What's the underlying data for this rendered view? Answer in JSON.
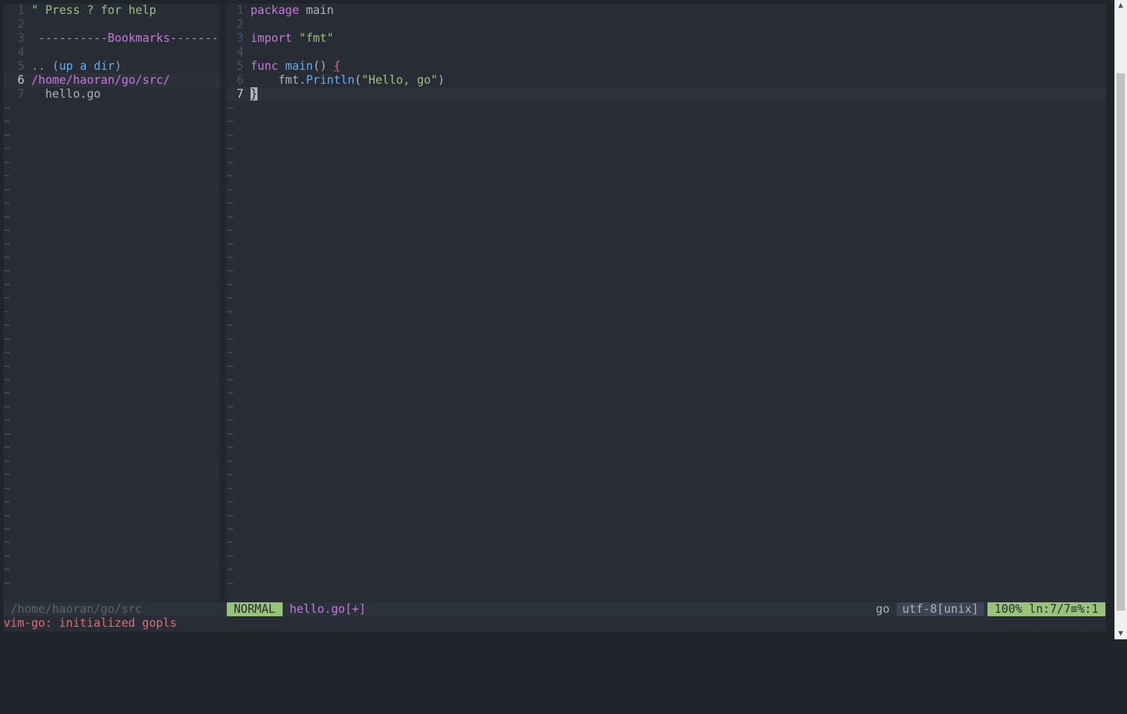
{
  "left_pane": {
    "lines": [
      {
        "num": "1",
        "text": "\" Press ? for help"
      },
      {
        "num": "2",
        "text": ""
      },
      {
        "num": "3",
        "text": " ----------Bookmarks-------"
      },
      {
        "num": "4",
        "text": ""
      },
      {
        "num": "5",
        "text": ".. (up a dir)"
      },
      {
        "num": "6",
        "text": "/home/haoran/go/src/"
      },
      {
        "num": "7",
        "text": "  hello.go"
      }
    ],
    "empty_marker": "~"
  },
  "right_pane": {
    "lines": [
      {
        "num": "1",
        "tokens": [
          "package",
          " main"
        ]
      },
      {
        "num": "2",
        "tokens": []
      },
      {
        "num": "3",
        "tokens": [
          "import",
          " \"fmt\""
        ]
      },
      {
        "num": "4",
        "tokens": []
      },
      {
        "num": "5",
        "tokens": [
          "func",
          " ",
          "main",
          "() ",
          "{"
        ]
      },
      {
        "num": "6",
        "tokens": [
          "    fmt.",
          "Println",
          "(",
          "\"Hello, go\"",
          ")"
        ]
      },
      {
        "num": "7",
        "tokens": [
          "}"
        ]
      }
    ],
    "empty_marker": "~"
  },
  "statusline": {
    "left_path": "/home/haoran/go/src",
    "mode": "NORMAL",
    "filename": "hello.go[+]",
    "filetype": "go",
    "encoding": "utf-8[unix]",
    "position": "100% ln:7/7≡%:1"
  },
  "message": "vim-go: initialized gopls",
  "colors": {
    "background": "#282c34",
    "mode_bg": "#98c379",
    "keyword": "#c678dd",
    "string": "#98c379",
    "function": "#61afef",
    "error_msg": "#e06c75"
  }
}
